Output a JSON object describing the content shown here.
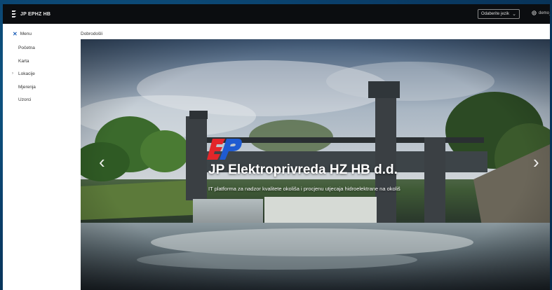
{
  "app": {
    "brand": "JP EPHZ HB"
  },
  "header": {
    "language_select": {
      "value": "Odaberite jezik"
    },
    "user": {
      "name": "demo_u"
    }
  },
  "sidebar": {
    "menu_label": "Menu",
    "items": [
      {
        "label": "Početna"
      },
      {
        "label": "Karta"
      },
      {
        "label": "Lokacije",
        "expandable": true
      },
      {
        "label": "Mjerenja"
      },
      {
        "label": "Uzorci"
      }
    ]
  },
  "main": {
    "page_title": "Dobrodošli",
    "hero": {
      "title": "JP Elektroprivreda HZ HB d.d.",
      "subtitle": "IT platforma za nadzor kvalitete okoliša i procjenu utjecaja hidroelektrane na okoliš"
    }
  },
  "colors": {
    "accent": "#1c5fb8",
    "topbar": "#0b0d10",
    "logo_red": "#e3262a",
    "logo_blue": "#1f5bd1"
  },
  "icons": {
    "logo": "ep-logo-icon",
    "menu_close": "close-icon",
    "lang_chevron": "chevron-down-icon",
    "user": "globe-icon",
    "carousel_prev": "chevron-left-icon",
    "carousel_next": "chevron-right-icon"
  }
}
